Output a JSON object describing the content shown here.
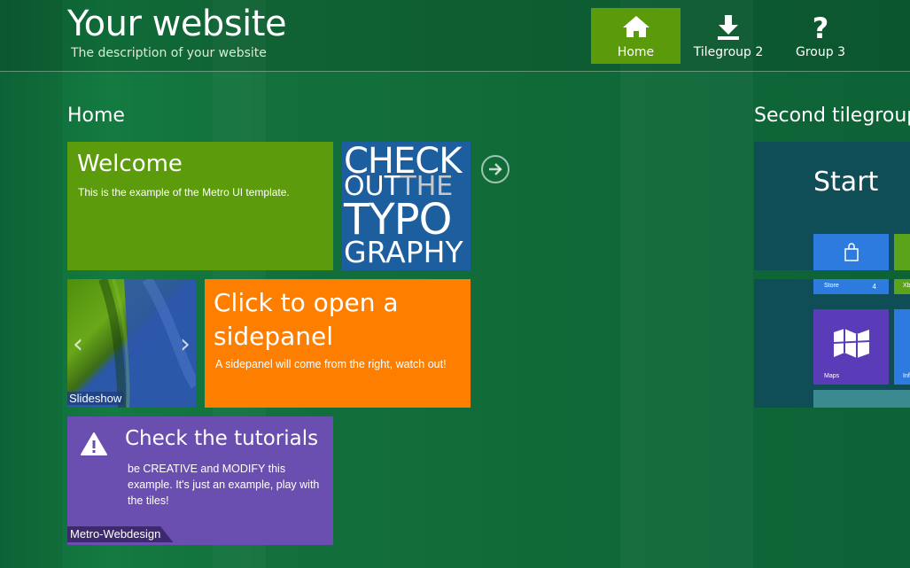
{
  "header": {
    "title": "Your website",
    "description": "The description of your website"
  },
  "nav": {
    "home": {
      "label": "Home",
      "icon": "home-icon"
    },
    "tilegroup2": {
      "label": "Tilegroup 2",
      "icon": "download-icon"
    },
    "group3": {
      "label": "Group 3",
      "icon": "help-icon"
    }
  },
  "sections": {
    "home": "Home",
    "second": "Second tilegroup"
  },
  "tiles": {
    "welcome": {
      "title": "Welcome",
      "text": "This is the example of the Metro UI template.",
      "color": "#5c9c0c"
    },
    "typography": {
      "line1": "CHECK",
      "line2a": "OUT",
      "line2b": "THE",
      "line3": "TYPO",
      "line4": "GRAPHY",
      "color": "#1d5e9e"
    },
    "slideshow": {
      "label": "Slideshow"
    },
    "sidepanel": {
      "title": "Click to open a sidepanel",
      "text": "A sidepanel will come from the right, watch out!",
      "color": "#fe7f00"
    },
    "tutorials": {
      "title": "Check the tutorials",
      "text": "be CREATIVE and MODIFY this example. It's just an example, play with the tiles!",
      "label": "Metro-Webdesign",
      "color": "#6b4fb0"
    },
    "start": {
      "title": "Start",
      "store_label": "Store",
      "store_count": "4",
      "xbox_label": "Xb",
      "maps_label": "Maps",
      "info_label": "Inf"
    }
  },
  "colors": {
    "background": "#0f6a3a",
    "accent": "#5b9b0b"
  }
}
